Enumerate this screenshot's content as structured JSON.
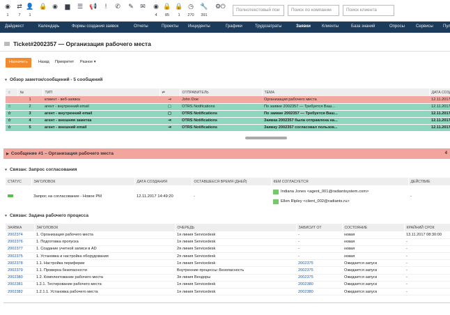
{
  "toolbar": {
    "icons": [
      {
        "name": "eye-icon",
        "glyph": "◉",
        "count": "1"
      },
      {
        "name": "repeat-icon",
        "glyph": "⇄",
        "count": "7"
      },
      {
        "name": "user-icon",
        "glyph": "👤",
        "count": "1"
      },
      {
        "name": "lock-icon",
        "glyph": "🔒",
        "count": ""
      },
      {
        "name": "eye-icon",
        "glyph": "◉",
        "count": ""
      },
      {
        "name": "folder-icon",
        "glyph": "▆",
        "count": ""
      },
      {
        "name": "list-icon",
        "glyph": "☰",
        "count": ""
      },
      {
        "name": "megaphone-icon",
        "glyph": "📢",
        "count": ""
      },
      {
        "name": "exclamation-icon",
        "glyph": "!",
        "count": ""
      },
      {
        "name": "phone-icon",
        "glyph": "✆",
        "count": ""
      },
      {
        "name": "edit-icon",
        "glyph": "✎",
        "count": ""
      },
      {
        "name": "mail-icon",
        "glyph": "✉",
        "count": ""
      },
      {
        "name": "watch-icon",
        "glyph": "◉",
        "count": "4"
      },
      {
        "name": "locked-tickets-icon",
        "glyph": "🔒",
        "count": "85"
      },
      {
        "name": "lock-alert-icon",
        "glyph": "🔒",
        "count": "1"
      },
      {
        "name": "clock-icon",
        "glyph": "◷",
        "count": "270"
      },
      {
        "name": "wrench-icon",
        "glyph": "🔧",
        "count": "391"
      },
      {
        "name": "settings-icon",
        "glyph": "⚙",
        "count": ""
      },
      {
        "name": "power-icon",
        "glyph": "⏻",
        "count": ""
      }
    ],
    "search_fulltext": "Полнотекстовый пои",
    "search_company": "Поиск по компании",
    "search_customer": "Поиск клиента"
  },
  "nav": [
    "Дайджест",
    "Календарь",
    "Формы создания заявок",
    "Отчеты",
    "Проекты",
    "Инциденты",
    "Графики",
    "Трудозатраты",
    "Заявки",
    "Клиенты",
    "База знаний",
    "Опросы",
    "Сервисы",
    "Пул"
  ],
  "nav_active": "Заявки",
  "page_title": "Ticket#2002357 — Организация рабочего места",
  "actions": {
    "primary": "Назначить",
    "back": "Назад",
    "priority": "Приоритет",
    "misc": "Разное ▾"
  },
  "articles": {
    "section_title": "Обзор заметок/сообщений - 5 сообщений",
    "columns": [
      "№",
      "ТИП",
      "⇄",
      "ОТПРАВИТЕЛЬ",
      "ТЕМА",
      "ДАТА СОЗДАН"
    ],
    "rows": [
      {
        "no": "1",
        "type": "клиент - веб-заявка",
        "dir": "⇥",
        "from": "John Doe",
        "subject": "Организация рабочего места",
        "date": "12.11.2017",
        "style": "pink",
        "bold": false
      },
      {
        "no": "2",
        "type": "агент - внутренний email",
        "dir": "▢",
        "from": "OTRS Notifications",
        "subject": "По заявке 2002357 — Требуется Ваш...",
        "date": "12.11.2017",
        "style": "green",
        "bold": false
      },
      {
        "no": "3",
        "type": "агент - внутренний email",
        "dir": "▢",
        "from": "OTRS Notifications",
        "subject": "По заявке 2002357 — Требуется Ваш...",
        "date": "12.11.2017",
        "style": "green",
        "bold": true
      },
      {
        "no": "4",
        "type": "агент - внешняя заметка",
        "dir": "⇥",
        "from": "OTRS Notifications",
        "subject": "Заявка 2002357 была отправлена на...",
        "date": "12.11.2017",
        "style": "green",
        "bold": true
      },
      {
        "no": "5",
        "type": "агент - внешний email",
        "dir": "⇥",
        "from": "OTRS Notifications",
        "subject": "Заявку 2002357 согласовал пользов...",
        "date": "12.11.2017",
        "style": "green",
        "bold": true
      }
    ]
  },
  "message_bar": {
    "title": "Сообщение #1 – Организация рабочего места",
    "end": "4"
  },
  "approval": {
    "section_title": "Связан: Запрос согласования",
    "columns": [
      "СТАТУС",
      "ЗАГОЛОВОК",
      "ДАТА СОЗДАНИЯ",
      "ОСТАВШЕЕСЯ ВРЕМЯ (ДНЕЙ)",
      "КЕМ СОГЛАСУЕТСЯ",
      "ДЕЙСТВИЕ"
    ],
    "title": "Запрос на согласование - Новое РМ",
    "created": "12.11.2017 14:49:20",
    "remaining": "-",
    "approvers": [
      "Indiana Jones <agent_001@radiantsystem.com>",
      "Ellen Ripley <client_002@radiants.ru>"
    ],
    "action": "-"
  },
  "tasks": {
    "section_title": "Связан: Задача рабочего процесса",
    "columns": [
      "ЗАЯВКА",
      "ЗАГОЛОВОК",
      "ОЧЕРЕДЬ",
      "ЗАВИСИТ ОТ",
      "СОСТОЯНИЕ",
      "КРАЙНИЙ СРОК"
    ],
    "rows": [
      {
        "id": "2002374",
        "title": "1. Организация рабочего места",
        "queue": "1я линия Servicedesk",
        "dep": "-",
        "state": "новая",
        "deadline": "13.11.2017 08:30:00"
      },
      {
        "id": "2002376",
        "title": "1. Подготовка пропуска",
        "queue": "1я линия Servicedesk",
        "dep": "-",
        "state": "новая",
        "deadline": "-"
      },
      {
        "id": "2002377",
        "title": "1. Создание учетной записи в AD",
        "queue": "2я линия Servicedesk",
        "dep": "-",
        "state": "новая",
        "deadline": "-"
      },
      {
        "id": "2002375",
        "title": "1. Установка и настройка оборудования",
        "queue": "2я линия Servicedesk",
        "dep": "-",
        "state": "новая",
        "deadline": "-"
      },
      {
        "id": "2002378",
        "title": "1.1. Настройка периферии",
        "queue": "1я линия Servicedesk",
        "dep": "2002375",
        "state": "Ожидается запуск",
        "deadline": "-"
      },
      {
        "id": "2002379",
        "title": "1.1. Проверка безопасности",
        "queue": "Внутренние процессы::Безопасность",
        "dep": "2002375",
        "state": "Ожидается запуск",
        "deadline": "-"
      },
      {
        "id": "2002380",
        "title": "1.2. Комплектование рабочего места",
        "queue": "3я линия Вендоры",
        "dep": "2002375",
        "state": "Ожидается запуск",
        "deadline": "-"
      },
      {
        "id": "2002381",
        "title": "1.2.1. Тестирование рабочего места",
        "queue": "1я линия Servicedesk",
        "dep": "2002380",
        "state": "Ожидается запуск",
        "deadline": "-"
      },
      {
        "id": "2002382",
        "title": "1.2.1.1. Установка рабочего места",
        "queue": "1я линия Servicedesk",
        "dep": "2002380",
        "state": "Ожидается запуск",
        "deadline": "-"
      }
    ]
  }
}
